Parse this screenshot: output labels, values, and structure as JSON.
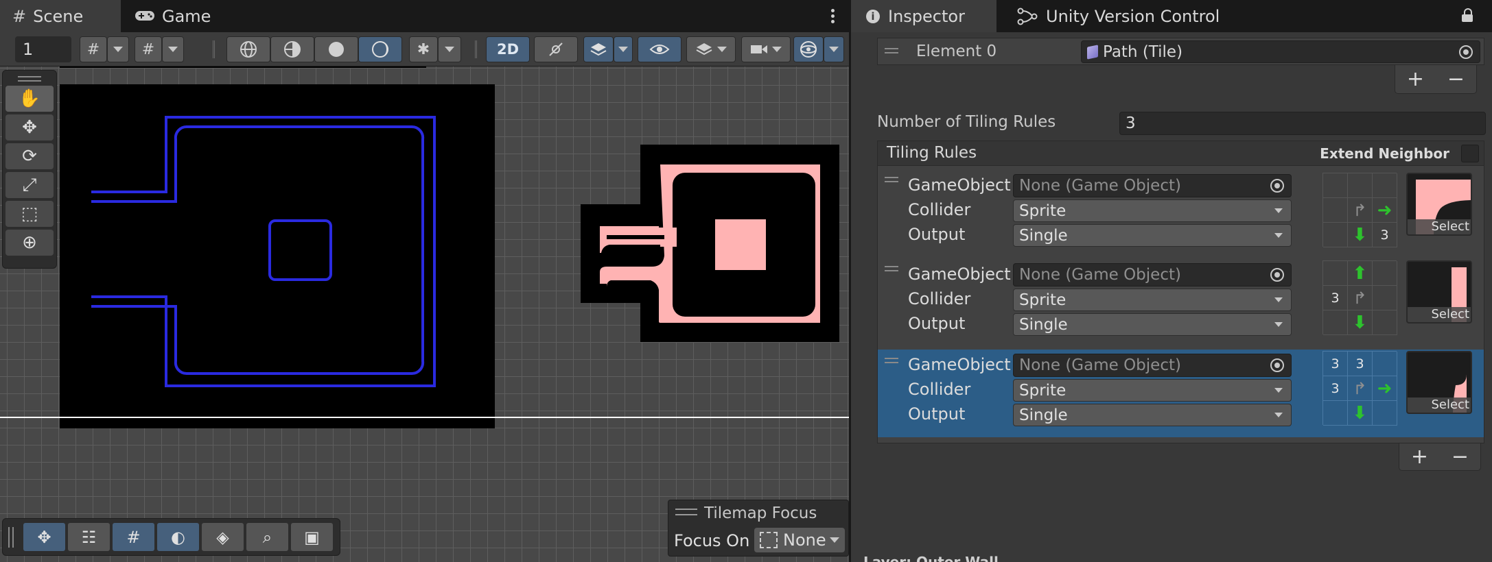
{
  "scene_window": {
    "tabs": [
      {
        "label": "Scene",
        "icon": "grid-icon",
        "active": true
      },
      {
        "label": "Game",
        "icon": "gamepad-icon",
        "active": false
      }
    ],
    "toolbar": {
      "grid_count": "1",
      "mode_2d_label": "2D"
    },
    "tool_icons": [
      "hand-icon",
      "move-icon",
      "rotate-icon",
      "scale-icon",
      "rect-icon",
      "transform-icon"
    ],
    "overlay_icons": [
      "move-icon",
      "tile-palette-icon",
      "grid-toggle-icon",
      "shading-icon",
      "layers-icon",
      "search-icon",
      "camera-icon"
    ],
    "tilemap_focus": {
      "title": "Tilemap Focus",
      "focus_on_label": "Focus On",
      "value": "None"
    }
  },
  "inspector": {
    "tabs": [
      {
        "label": "Inspector",
        "icon": "info-icon",
        "active": true
      },
      {
        "label": "Unity Version Control",
        "icon": "branch-icon",
        "active": false
      }
    ],
    "element0": {
      "label": "Element 0",
      "value": "Path (Tile)"
    },
    "plus": "+",
    "minus": "−",
    "tiling_rules_count": {
      "label": "Number of Tiling Rules",
      "value": "3"
    },
    "tiling_rules": {
      "title": "Tiling Rules",
      "extend_neighbor_label": "Extend Neighbor",
      "select_label": "Select",
      "game_object_label": "GameObject",
      "collider_label": "Collider",
      "output_label": "Output",
      "rules": [
        {
          "game_object": "None (Game Object)",
          "collider": "Sprite",
          "output": "Single",
          "selected": false,
          "grid": [
            "",
            "",
            "",
            "",
            "self",
            "right",
            "",
            "down",
            "3"
          ]
        },
        {
          "game_object": "None (Game Object)",
          "collider": "Sprite",
          "output": "Single",
          "selected": false,
          "grid": [
            "",
            "up",
            "",
            "3",
            "self",
            "",
            "",
            "down",
            ""
          ]
        },
        {
          "game_object": "None (Game Object)",
          "collider": "Sprite",
          "output": "Single",
          "selected": true,
          "grid": [
            "3",
            "3",
            "",
            "3",
            "self",
            "right",
            "",
            "down",
            ""
          ]
        }
      ]
    },
    "next_section_partial": "Layer: Outer Wall"
  },
  "colors": {
    "accent_blue": "#2c5d87",
    "path_blue": "#2a2ae0",
    "path_pink": "#ffb3b3",
    "arrow_green": "#2dc22d"
  }
}
